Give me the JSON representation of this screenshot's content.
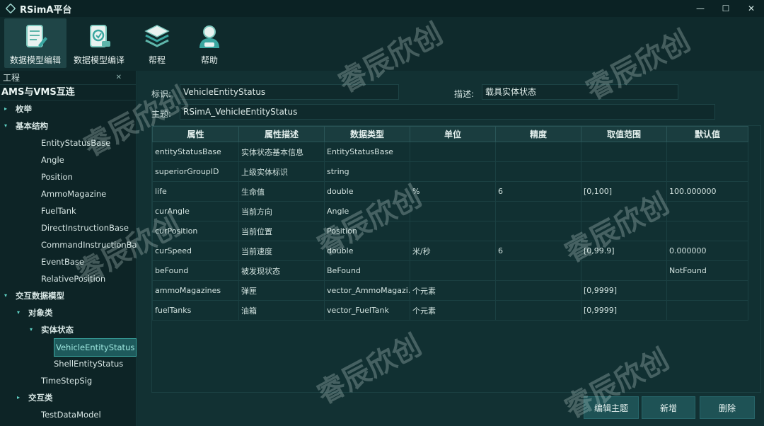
{
  "window": {
    "title": "RSimA平台",
    "minimize": "—",
    "maximize": "☐",
    "close": "✕"
  },
  "toolbar": {
    "items": [
      {
        "label": "数据模型编辑"
      },
      {
        "label": "数据模型编译"
      },
      {
        "label": "帮程"
      },
      {
        "label": "帮助"
      }
    ]
  },
  "left_panel": {
    "header": "工程",
    "close": "✕",
    "project": "AMS与VMS互连",
    "tree": [
      {
        "label": "枚举",
        "depth": 0,
        "arrow": "▸",
        "bold": true
      },
      {
        "label": "基本结构",
        "depth": 0,
        "arrow": "▾",
        "bold": true
      },
      {
        "label": "EntityStatusBase",
        "depth": 1
      },
      {
        "label": "Angle",
        "depth": 1
      },
      {
        "label": "Position",
        "depth": 1
      },
      {
        "label": "AmmoMagazine",
        "depth": 1
      },
      {
        "label": "FuelTank",
        "depth": 1
      },
      {
        "label": "DirectInstructionBase",
        "depth": 1
      },
      {
        "label": "CommandInstructionBase",
        "depth": 1
      },
      {
        "label": "EventBase",
        "depth": 1
      },
      {
        "label": "RelativePosition",
        "depth": 1
      },
      {
        "label": "交互数据模型",
        "depth": 0,
        "arrow": "▾",
        "bold": true
      },
      {
        "label": "对象类",
        "depth": 1,
        "arrow": "▾",
        "bold": true
      },
      {
        "label": "实体状态",
        "depth": 2,
        "arrow": "▾",
        "bold": true
      },
      {
        "label": "VehicleEntityStatus",
        "depth": 3,
        "selected": true
      },
      {
        "label": "ShellEntityStatus",
        "depth": 3
      },
      {
        "label": "TimeStepSig",
        "depth": 2
      },
      {
        "label": "交互类",
        "depth": 1,
        "arrow": "▸",
        "bold": true
      },
      {
        "label": "TestDataModel",
        "depth": 1
      }
    ]
  },
  "form": {
    "identifier_label": "标识:",
    "identifier_value": "VehicleEntityStatus",
    "description_label": "描述:",
    "description_value": "载具实体状态",
    "topic_label": "主题:",
    "topic_value": "RSimA_VehicleEntityStatus"
  },
  "table": {
    "headers": [
      "属性",
      "属性描述",
      "数据类型",
      "单位",
      "精度",
      "取值范围",
      "默认值"
    ],
    "rows": [
      [
        "entityStatusBase",
        "实体状态基本信息",
        "EntityStatusBase",
        "",
        "",
        "",
        ""
      ],
      [
        "superiorGroupID",
        "上级实体标识",
        "string",
        "",
        "",
        "",
        ""
      ],
      [
        "life",
        "生命值",
        "double",
        "%",
        "6",
        "[0,100]",
        "100.000000"
      ],
      [
        "curAngle",
        "当前方向",
        "Angle",
        "",
        "",
        "",
        ""
      ],
      [
        "curPosition",
        "当前位置",
        "Position",
        "",
        "",
        "",
        ""
      ],
      [
        "curSpeed",
        "当前速度",
        "double",
        "米/秒",
        "6",
        "[0,99.9]",
        "0.000000"
      ],
      [
        "beFound",
        "被发现状态",
        "BeFound",
        "",
        "",
        "",
        "NotFound"
      ],
      [
        "ammoMagazines",
        "弹匣",
        "vector_AmmoMagazi...",
        "个元素",
        "",
        "[0,9999]",
        ""
      ],
      [
        "fuelTanks",
        "油箱",
        "vector_FuelTank",
        "个元素",
        "",
        "[0,9999]",
        ""
      ]
    ]
  },
  "buttons": {
    "edit_topic": "编辑主题",
    "add": "新增",
    "delete": "删除"
  },
  "watermark": "睿辰欣创",
  "colors": {
    "accent": "#3aa6a0",
    "background": "#0f2a2c",
    "header": "#1a3d3f"
  }
}
